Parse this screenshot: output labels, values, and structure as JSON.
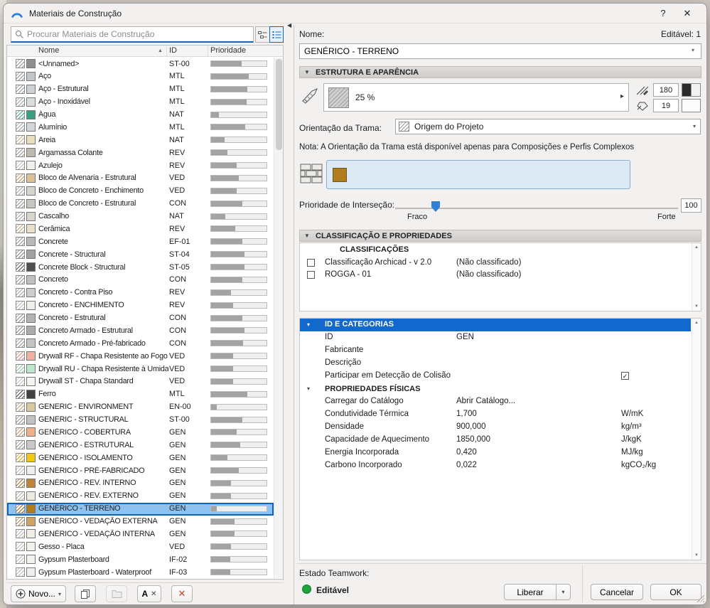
{
  "window": {
    "title": "Materiais de Construção",
    "help": "?",
    "close": "✕"
  },
  "search": {
    "placeholder": "Procurar Materiais de Construção"
  },
  "list": {
    "columns": [
      "Nome",
      "ID",
      "Prioridade"
    ],
    "rows": [
      {
        "name": "<Unnamed>",
        "id": "ST-00",
        "priority": 55,
        "color": "#8f8f8f",
        "hatch": "#8f8f8f",
        "selected": false
      },
      {
        "name": "Aço",
        "id": "MTL",
        "priority": 68,
        "color": "#c2c6c9",
        "hatch": "#8a9096",
        "selected": false
      },
      {
        "name": "Aço - Estrutural",
        "id": "MTL",
        "priority": 66,
        "color": "#cdd1d4",
        "hatch": "#8a9096",
        "selected": false
      },
      {
        "name": "Aço - Inoxidável",
        "id": "MTL",
        "priority": 64,
        "color": "#dbdedf",
        "hatch": "#9aa0a4",
        "selected": false
      },
      {
        "name": "Água",
        "id": "NAT",
        "priority": 14,
        "color": "#3aa082",
        "hatch": "#3aa082",
        "selected": false
      },
      {
        "name": "Alumínio",
        "id": "MTL",
        "priority": 62,
        "color": "#d4d7d9",
        "hatch": "#9aa0a4",
        "selected": false
      },
      {
        "name": "Areia",
        "id": "NAT",
        "priority": 24,
        "color": "#e9ddc0",
        "hatch": "#c4b183",
        "selected": false
      },
      {
        "name": "Argamassa Colante",
        "id": "REV",
        "priority": 30,
        "color": "#bfbab0",
        "hatch": "#9a958b",
        "selected": false
      },
      {
        "name": "Azulejo",
        "id": "REV",
        "priority": 46,
        "color": "#f1f1ee",
        "hatch": "#b9b9b4",
        "selected": false
      },
      {
        "name": "Bloco de Alvenaria - Estrutural",
        "id": "VED",
        "priority": 50,
        "color": "#ddc196",
        "hatch": "#b8935a",
        "selected": false
      },
      {
        "name": "Bloco de Concreto - Enchimento",
        "id": "VED",
        "priority": 46,
        "color": "#d6d6d1",
        "hatch": "#a3a39d",
        "selected": false
      },
      {
        "name": "Bloco de Concreto - Estrutural",
        "id": "CON",
        "priority": 56,
        "color": "#c6c6c1",
        "hatch": "#96968f",
        "selected": false
      },
      {
        "name": "Cascalho",
        "id": "NAT",
        "priority": 26,
        "color": "#d9d6cd",
        "hatch": "#a8a398",
        "selected": false
      },
      {
        "name": "Cerâmica",
        "id": "REV",
        "priority": 44,
        "color": "#eadfc8",
        "hatch": "#c2a678",
        "selected": false
      },
      {
        "name": "Concrete",
        "id": "EF-01",
        "priority": 56,
        "color": "#b8b8b8",
        "hatch": "#8d8d8d",
        "selected": false
      },
      {
        "name": "Concrete - Structural",
        "id": "ST-04",
        "priority": 60,
        "color": "#a2a2a2",
        "hatch": "#7e7e7e",
        "selected": false
      },
      {
        "name": "Concrete Block - Structural",
        "id": "ST-05",
        "priority": 60,
        "color": "#4f4f4f",
        "hatch": "#4f4f4f",
        "selected": false
      },
      {
        "name": "Concreto",
        "id": "CON",
        "priority": 56,
        "color": "#bfbfbf",
        "hatch": "#909090",
        "selected": false
      },
      {
        "name": "Concreto - Contra Piso",
        "id": "REV",
        "priority": 36,
        "color": "#cccccc",
        "hatch": "#9b9b9b",
        "selected": false
      },
      {
        "name": "Concreto - ENCHIMENTO",
        "id": "REV",
        "priority": 40,
        "color": "#efefec",
        "hatch": "#b5b5b0",
        "selected": false
      },
      {
        "name": "Concreto - Estrutural",
        "id": "CON",
        "priority": 56,
        "color": "#b3b3b3",
        "hatch": "#888888",
        "selected": false
      },
      {
        "name": "Concreto Armado - Estrutural",
        "id": "CON",
        "priority": 60,
        "color": "#ababab",
        "hatch": "#828282",
        "selected": false
      },
      {
        "name": "Concreto Armado - Pré-fabricado",
        "id": "CON",
        "priority": 58,
        "color": "#c4c4c4",
        "hatch": "#939393",
        "selected": false
      },
      {
        "name": "Drywall RF - Chapa Resistente ao Fogo",
        "id": "VED",
        "priority": 40,
        "color": "#f2b0a5",
        "hatch": "#d3887c",
        "selected": false
      },
      {
        "name": "Drywall RU - Chapa Resistente à Umidade",
        "id": "VED",
        "priority": 40,
        "color": "#bce6cc",
        "hatch": "#8cc4a2",
        "selected": false
      },
      {
        "name": "Drywall ST - Chapa Standard",
        "id": "VED",
        "priority": 40,
        "color": "#f4f4f1",
        "hatch": "#bcbcb7",
        "selected": false
      },
      {
        "name": "Ferro",
        "id": "MTL",
        "priority": 66,
        "color": "#414144",
        "hatch": "#414144",
        "selected": false
      },
      {
        "name": "GENERIC - ENVIRONMENT",
        "id": "EN-00",
        "priority": 10,
        "color": "#d9c9a1",
        "hatch": "#b3a276",
        "selected": false
      },
      {
        "name": "GENERIC - STRUCTURAL",
        "id": "ST-00",
        "priority": 56,
        "color": "#c2c2c2",
        "hatch": "#8f8f8f",
        "selected": false
      },
      {
        "name": "GENÉRICO - COBERTURA",
        "id": "GEN",
        "priority": 46,
        "color": "#f0b189",
        "hatch": "#d08a5b",
        "selected": false
      },
      {
        "name": "GENÉRICO - ESTRUTURAL",
        "id": "GEN",
        "priority": 52,
        "color": "#c8c8c8",
        "hatch": "#959595",
        "selected": false
      },
      {
        "name": "GENÉRICO - ISOLAMENTO",
        "id": "GEN",
        "priority": 30,
        "color": "#f3c515",
        "hatch": "#cba311",
        "selected": false
      },
      {
        "name": "GENÉRICO - PRÉ-FABRICADO",
        "id": "GEN",
        "priority": 50,
        "color": "#eeeeec",
        "hatch": "#b4b4b0",
        "selected": false
      },
      {
        "name": "GENÉRICO - REV. INTERNO",
        "id": "GEN",
        "priority": 36,
        "color": "#c08438",
        "hatch": "#a06c28",
        "selected": false
      },
      {
        "name": "GENÉRICO - REV. EXTERNO",
        "id": "GEN",
        "priority": 36,
        "color": "#f0ebe2",
        "hatch": "#b8b2a5",
        "selected": false
      },
      {
        "name": "GENÉRICO - TERRENO",
        "id": "GEN",
        "priority": 10,
        "color": "#b07c1e",
        "hatch": "#8f6418",
        "selected": true
      },
      {
        "name": "GENÉRICO - VEDAÇÃO EXTERNA",
        "id": "GEN",
        "priority": 42,
        "color": "#cfa267",
        "hatch": "#ad8348",
        "selected": false
      },
      {
        "name": "GENÉRICO - VEDAÇÃO INTERNA",
        "id": "GEN",
        "priority": 42,
        "color": "#f2efe8",
        "hatch": "#bab5aa",
        "selected": false
      },
      {
        "name": "Gesso - Placa",
        "id": "VED",
        "priority": 36,
        "color": "#f4f2ed",
        "hatch": "#bcb9b1",
        "selected": false
      },
      {
        "name": "Gypsum Plasterboard",
        "id": "IF-02",
        "priority": 34,
        "color": "#f2f2ef",
        "hatch": "#b9b9b5",
        "selected": false
      },
      {
        "name": "Gypsum Plasterboard - Waterproof",
        "id": "IF-03",
        "priority": 34,
        "color": "#edf0ec",
        "hatch": "#b3b8b1",
        "selected": false
      }
    ]
  },
  "toolbar": {
    "new_label": "Novo..."
  },
  "detail": {
    "name_label": "Nome:",
    "editable_count": "Editável: 1",
    "name_value": "GENÉRICO - TERRENO",
    "structure_section": "ESTRUTURA E APARÊNCIA",
    "fill_percent": "25 %",
    "fill_pen": "180",
    "background_pen": "19",
    "orientation_label": "Orientação da Trama:",
    "orientation_value": "Origem do Projeto",
    "note": "Nota: A Orientação da Trama está disponível apenas para Composições e Perfis Complexos",
    "surface_color": "#b07c1e",
    "intersection_label": "Prioridade de Interseção:",
    "intersection_value": "100",
    "weak_label": "Fraco",
    "strong_label": "Forte",
    "classification_section": "CLASSIFICAÇÃO E PROPRIEDADES",
    "classifications_header": "CLASSIFICAÇÕES",
    "classifications": [
      {
        "name": "Classificação Archicad - v 2.0",
        "value": "(Não classificado)",
        "checked": false
      },
      {
        "name": "ROGGA - 01",
        "value": "(Não classificado)",
        "checked": false
      }
    ],
    "id_section": "ID E CATEGORIAS",
    "properties": [
      {
        "type": "item",
        "name": "ID",
        "value": "GEN",
        "unit": ""
      },
      {
        "type": "item",
        "name": "Fabricante",
        "value": "",
        "unit": ""
      },
      {
        "type": "item",
        "name": "Descrição",
        "value": "",
        "unit": ""
      },
      {
        "type": "check",
        "name": "Participar em Detecção de Colisão",
        "checked": true
      },
      {
        "type": "subheader",
        "name": "PROPRIEDADES FÍSICAS"
      },
      {
        "type": "item",
        "name": "Carregar do Catálogo",
        "value": "Abrir Catálogo...",
        "unit": ""
      },
      {
        "type": "item",
        "name": "Condutividade Térmica",
        "value": "1,700",
        "unit": "W/mK"
      },
      {
        "type": "item",
        "name": "Densidade",
        "value": "900,000",
        "unit": "kg/m³"
      },
      {
        "type": "item",
        "name": "Capacidade de Aquecimento",
        "value": "1850,000",
        "unit": "J/kgK"
      },
      {
        "type": "item",
        "name": "Energia Incorporada",
        "value": "0,420",
        "unit": "MJ/kg"
      },
      {
        "type": "item",
        "name": "Carbono Incorporado",
        "value": "0,022",
        "unit": "kgCO₂/kg"
      }
    ],
    "teamwork_label": "Estado Teamwork:",
    "teamwork_status": "Editável",
    "status_color": "#1fa33c",
    "release_label": "Liberar",
    "cancel_label": "Cancelar",
    "ok_label": "OK"
  }
}
